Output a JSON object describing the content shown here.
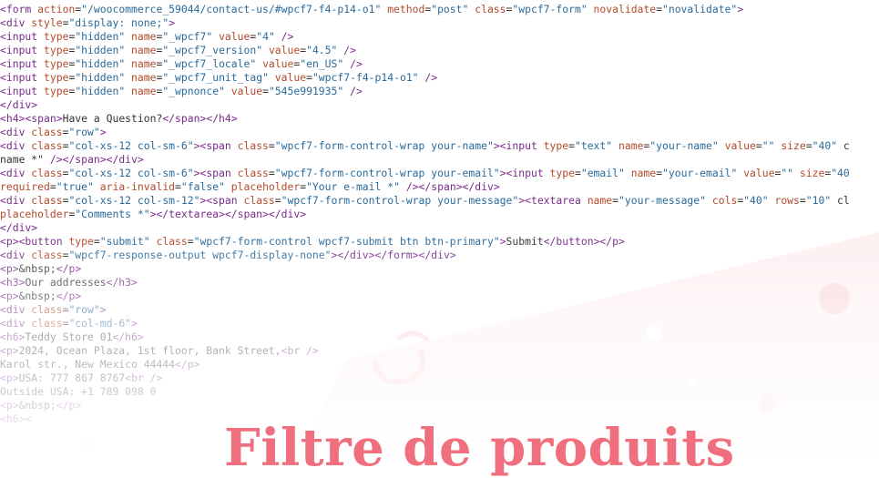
{
  "code_lines": [
    "<form action=\"/woocommerce_59044/contact-us/#wpcf7-f4-p14-o1\" method=\"post\" class=\"wpcf7-form\" novalidate=\"novalidate\">",
    "<div style=\"display: none;\">",
    "<input type=\"hidden\" name=\"_wpcf7\" value=\"4\" />",
    "<input type=\"hidden\" name=\"_wpcf7_version\" value=\"4.5\" />",
    "<input type=\"hidden\" name=\"_wpcf7_locale\" value=\"en_US\" />",
    "<input type=\"hidden\" name=\"_wpcf7_unit_tag\" value=\"wpcf7-f4-p14-o1\" />",
    "<input type=\"hidden\" name=\"_wpnonce\" value=\"545e991935\" />",
    "</div>",
    "<h4><span>Have a Question?</span></h4>",
    "<div class=\"row\">",
    "<div class=\"col-xs-12 col-sm-6\"><span class=\"wpcf7-form-control-wrap your-name\"><input type=\"text\" name=\"your-name\" value=\"\" size=\"40\" c",
    "name *\" /></span></div>",
    "<div class=\"col-xs-12 col-sm-6\"><span class=\"wpcf7-form-control-wrap your-email\"><input type=\"email\" name=\"your-email\" value=\"\" size=\"40",
    "required=\"true\" aria-invalid=\"false\" placeholder=\"Your e-mail *\" /></span></div>",
    "<div class=\"col-xs-12 col-sm-12\"><span class=\"wpcf7-form-control-wrap your-message\"><textarea name=\"your-message\" cols=\"40\" rows=\"10\" cl",
    "placeholder=\"Comments *\"></textarea></span></div>",
    "</div>",
    "<p><button type=\"submit\" class=\"wpcf7-form-control wpcf7-submit btn btn-primary\">Submit</button></p>",
    "<div class=\"wpcf7-response-output wpcf7-display-none\"></div></form></div>",
    "<p>&nbsp;</p>",
    "<h3>Our addresses</h3>",
    "<p>&nbsp;</p>",
    "<div class=\"row\">",
    "<div class=\"col-md-6\">",
    "<h6>Teddy Store 01</h6>",
    "<p>2024, Ocean Plaza, 1st floor, Bank Street,<br />",
    "Karol str., New Mexico 44444</p>",
    "<p>USA: 777 867 8767<br />",
    "Outside USA: +1 789 098 0",
    "<p>&nbsp;</p>",
    "<h6><"
  ],
  "heading": "Filtre de produits",
  "colors": {
    "heading": "#f06f7e",
    "decor": "#fbd4d8",
    "background_tint": "#fdf1f2",
    "code_text": "#4a4a4a"
  }
}
